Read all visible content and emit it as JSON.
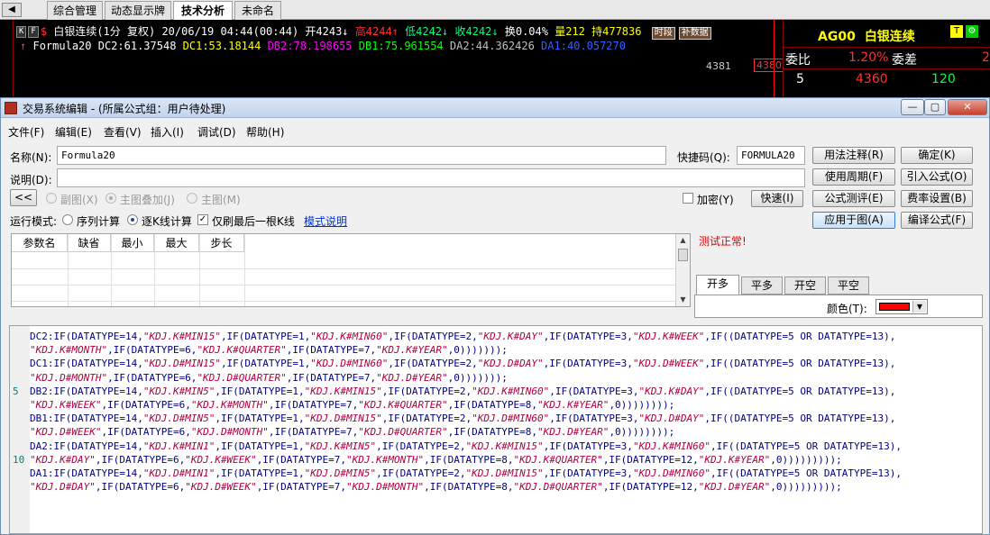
{
  "tabs": [
    "综合管理",
    "动态显示牌",
    "技术分析",
    "未命名"
  ],
  "chart": {
    "symbol": "白银连续(1分 复权)",
    "datetime": "20/06/19 04:44(00:44)",
    "open": "开4243↓",
    "high": "高4244↑",
    "low": "低4242↓",
    "close": "收4242↓",
    "turnover": "换0.04%",
    "volume": "量212",
    "position": "持477836",
    "btn_period": "时段",
    "btn_supplement": "补数据",
    "formula_name": "Formula20",
    "indicators": [
      {
        "text": "DC2:61.37548",
        "color": "#ffffff"
      },
      {
        "text": "DC1:53.18144",
        "color": "#ffff00"
      },
      {
        "text": "DB2:78.198655",
        "color": "#ff00ff"
      },
      {
        "text": "DB1:75.961554",
        "color": "#00ff00"
      },
      {
        "text": "DA2:44.362426",
        "color": "#c0c0c0"
      },
      {
        "text": "DA1:40.057270",
        "color": "#3060ff"
      }
    ],
    "price_label": "4381",
    "price_red": "4380"
  },
  "quote": {
    "code": "AG00",
    "name": "白银连续",
    "badge_t": "T",
    "badge_g": "⚙",
    "weibi_label": "委比",
    "weibi_value": "1.20%",
    "weicha_label": "委差",
    "weicha_value": "2",
    "row_num": "5",
    "row_price": "4360",
    "row_vol": "120"
  },
  "dialog": {
    "title": "交易系统编辑 - (所属公式组：用户待处理)",
    "menus": [
      "文件(F)",
      "编辑(E)",
      "查看(V)",
      "插入(I)",
      "调试(D)",
      "帮助(H)"
    ],
    "name_label": "名称(N):",
    "name_value": "Formula20",
    "shortcut_label": "快捷码(Q):",
    "shortcut_value": "FORMULA20",
    "desc_label": "说明(D):",
    "desc_value": "",
    "btn_back": "<<",
    "radio_subgraph": "副图(X)",
    "radio_overlay": "主图叠加(J)",
    "radio_main": "主图(M)",
    "encrypt_label": "加密(Y)",
    "btn_quick": "快速(I)",
    "run_mode_label": "运行模式:",
    "run_seq": "序列计算",
    "run_kline": "逐K线计算",
    "only_last": "仅刷最后一根K线",
    "mode_help": "模式说明",
    "buttons_right": [
      "用法注释(R)",
      "确定(K)",
      "使用周期(F)",
      "引入公式(O)",
      "公式测评(E)",
      "费率设置(B)",
      "应用于图(A)",
      "编译公式(F)"
    ],
    "param_headers": [
      "参数名",
      "缺省",
      "最小",
      "最大",
      "步长"
    ],
    "status": "测试正常!",
    "color_tabs": [
      "开多",
      "平多",
      "开空",
      "平空"
    ],
    "color_label": "颜色(T):",
    "color_value": "#ff0000",
    "line_numbers": [
      "5",
      "10"
    ]
  },
  "code_lines": [
    [
      [
        "k",
        "DC2:IF(DATATYPE=14,"
      ],
      [
        "s",
        "\"KDJ.K#MIN15\""
      ],
      [
        "k",
        ",IF(DATATYPE=1,"
      ],
      [
        "s",
        "\"KDJ.K#MIN60\""
      ],
      [
        "k",
        ",IF(DATATYPE=2,"
      ],
      [
        "s",
        "\"KDJ.K#DAY\""
      ],
      [
        "k",
        ",IF(DATATYPE=3,"
      ],
      [
        "s",
        "\"KDJ.K#WEEK\""
      ],
      [
        "k",
        ",IF((DATATYPE=5 OR DATATYPE=13),"
      ]
    ],
    [
      [
        "s",
        "\"KDJ.K#MONTH\""
      ],
      [
        "k",
        ",IF(DATATYPE=6,"
      ],
      [
        "s",
        "\"KDJ.K#QUARTER\""
      ],
      [
        "k",
        ",IF(DATATYPE=7,"
      ],
      [
        "s",
        "\"KDJ.K#YEAR\""
      ],
      [
        "k",
        ",0)))))));"
      ]
    ],
    [
      [
        "k",
        "DC1:IF(DATATYPE=14,"
      ],
      [
        "s",
        "\"KDJ.D#MIN15\""
      ],
      [
        "k",
        ",IF(DATATYPE=1,"
      ],
      [
        "s",
        "\"KDJ.D#MIN60\""
      ],
      [
        "k",
        ",IF(DATATYPE=2,"
      ],
      [
        "s",
        "\"KDJ.D#DAY\""
      ],
      [
        "k",
        ",IF(DATATYPE=3,"
      ],
      [
        "s",
        "\"KDJ.D#WEEK\""
      ],
      [
        "k",
        ",IF((DATATYPE=5 OR DATATYPE=13),"
      ]
    ],
    [
      [
        "s",
        "\"KDJ.D#MONTH\""
      ],
      [
        "k",
        ",IF(DATATYPE=6,"
      ],
      [
        "s",
        "\"KDJ.D#QUARTER\""
      ],
      [
        "k",
        ",IF(DATATYPE=7,"
      ],
      [
        "s",
        "\"KDJ.D#YEAR\""
      ],
      [
        "k",
        ",0)))))));"
      ]
    ],
    [
      [
        "k",
        "DB2:IF(DATATYPE=14,"
      ],
      [
        "s",
        "\"KDJ.K#MIN5\""
      ],
      [
        "k",
        ",IF(DATATYPE=1,"
      ],
      [
        "s",
        "\"KDJ.K#MIN15\""
      ],
      [
        "k",
        ",IF(DATATYPE=2,"
      ],
      [
        "s",
        "\"KDJ.K#MIN60\""
      ],
      [
        "k",
        ",IF(DATATYPE=3,"
      ],
      [
        "s",
        "\"KDJ.K#DAY\""
      ],
      [
        "k",
        ",IF((DATATYPE=5 OR DATATYPE=13),"
      ]
    ],
    [
      [
        "s",
        "\"KDJ.K#WEEK\""
      ],
      [
        "k",
        ",IF(DATATYPE=6,"
      ],
      [
        "s",
        "\"KDJ.K#MONTH\""
      ],
      [
        "k",
        ",IF(DATATYPE=7,"
      ],
      [
        "s",
        "\"KDJ.K#QUARTER\""
      ],
      [
        "k",
        ",IF(DATATYPE=8,"
      ],
      [
        "s",
        "\"KDJ.K#YEAR\""
      ],
      [
        "k",
        ",0))))))));"
      ]
    ],
    [
      [
        "k",
        "DB1:IF(DATATYPE=14,"
      ],
      [
        "s",
        "\"KDJ.D#MIN5\""
      ],
      [
        "k",
        ",IF(DATATYPE=1,"
      ],
      [
        "s",
        "\"KDJ.D#MIN15\""
      ],
      [
        "k",
        ",IF(DATATYPE=2,"
      ],
      [
        "s",
        "\"KDJ.D#MIN60\""
      ],
      [
        "k",
        ",IF(DATATYPE=3,"
      ],
      [
        "s",
        "\"KDJ.D#DAY\""
      ],
      [
        "k",
        ",IF((DATATYPE=5 OR DATATYPE=13),"
      ]
    ],
    [
      [
        "s",
        "\"KDJ.D#WEEK\""
      ],
      [
        "k",
        ",IF(DATATYPE=6,"
      ],
      [
        "s",
        "\"KDJ.D#MONTH\""
      ],
      [
        "k",
        ",IF(DATATYPE=7,"
      ],
      [
        "s",
        "\"KDJ.D#QUARTER\""
      ],
      [
        "k",
        ",IF(DATATYPE=8,"
      ],
      [
        "s",
        "\"KDJ.D#YEAR\""
      ],
      [
        "k",
        ",0))))))));"
      ]
    ],
    [
      [
        "k",
        "DA2:IF(DATATYPE=14,"
      ],
      [
        "s",
        "\"KDJ.K#MIN1\""
      ],
      [
        "k",
        ",IF(DATATYPE=1,"
      ],
      [
        "s",
        "\"KDJ.K#MIN5\""
      ],
      [
        "k",
        ",IF(DATATYPE=2,"
      ],
      [
        "s",
        "\"KDJ.K#MIN15\""
      ],
      [
        "k",
        ",IF(DATATYPE=3,"
      ],
      [
        "s",
        "\"KDJ.K#MIN60\""
      ],
      [
        "k",
        ",IF((DATATYPE=5 OR DATATYPE=13),"
      ]
    ],
    [
      [
        "s",
        "\"KDJ.K#DAY\""
      ],
      [
        "k",
        ",IF(DATATYPE=6,"
      ],
      [
        "s",
        "\"KDJ.K#WEEK\""
      ],
      [
        "k",
        ",IF(DATATYPE=7,"
      ],
      [
        "s",
        "\"KDJ.K#MONTH\""
      ],
      [
        "k",
        ",IF(DATATYPE=8,"
      ],
      [
        "s",
        "\"KDJ.K#QUARTER\""
      ],
      [
        "k",
        ",IF(DATATYPE=12,"
      ],
      [
        "s",
        "\"KDJ.K#YEAR\""
      ],
      [
        "k",
        ",0)))))))));"
      ]
    ],
    [
      [
        "k",
        "DA1:IF(DATATYPE=14,"
      ],
      [
        "s",
        "\"KDJ.D#MIN1\""
      ],
      [
        "k",
        ",IF(DATATYPE=1,"
      ],
      [
        "s",
        "\"KDJ.D#MIN5\""
      ],
      [
        "k",
        ",IF(DATATYPE=2,"
      ],
      [
        "s",
        "\"KDJ.D#MIN15\""
      ],
      [
        "k",
        ",IF(DATATYPE=3,"
      ],
      [
        "s",
        "\"KDJ.D#MIN60\""
      ],
      [
        "k",
        ",IF((DATATYPE=5 OR DATATYPE=13),"
      ]
    ],
    [
      [
        "s",
        "\"KDJ.D#DAY\""
      ],
      [
        "k",
        ",IF(DATATYPE=6,"
      ],
      [
        "s",
        "\"KDJ.D#WEEK\""
      ],
      [
        "k",
        ",IF(DATATYPE=7,"
      ],
      [
        "s",
        "\"KDJ.D#MONTH\""
      ],
      [
        "k",
        ",IF(DATATYPE=8,"
      ],
      [
        "s",
        "\"KDJ.D#QUARTER\""
      ],
      [
        "k",
        ",IF(DATATYPE=12,"
      ],
      [
        "s",
        "\"KDJ.D#YEAR\""
      ],
      [
        "k",
        ",0)))))))));"
      ]
    ]
  ]
}
